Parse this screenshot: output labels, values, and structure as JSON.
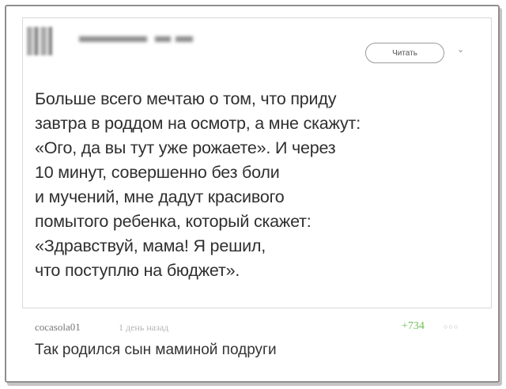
{
  "post": {
    "read_button_label": "Читать",
    "lines": [
      "Больше всего мечтаю о том, что приду",
      "завтра в роддом на осмотр, а мне скажут:",
      "«Ого, да вы тут уже рожаете». И через",
      "10 минут, совершенно без боли",
      "и мучений, мне дадут красивого",
      "помытого ребенка, который скажет:",
      "«Здравствуй, мама! Я решил,",
      "что поступлю на бюджет»."
    ]
  },
  "comment": {
    "username": "cocasola01",
    "time": "1 день назад",
    "score": "+734",
    "text": "Так родился сын маминой подруги"
  },
  "icons": {
    "avatar": "blurred-avatar",
    "chevron": "chevron-down-icon",
    "more": "more-icon"
  }
}
